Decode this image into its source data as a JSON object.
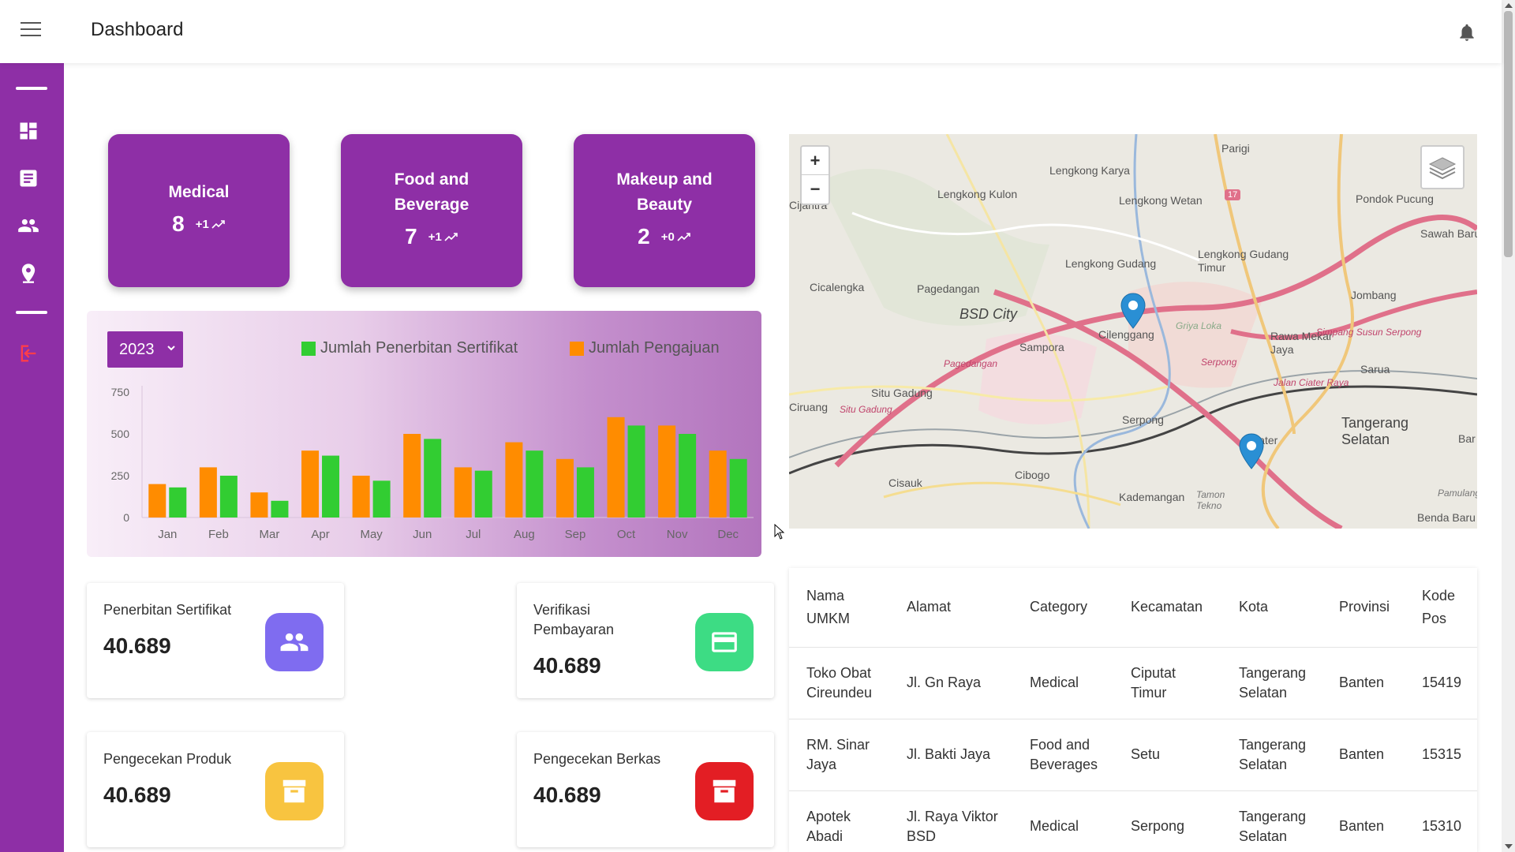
{
  "header": {
    "title": "Dashboard"
  },
  "sidebar": {
    "items": [
      {
        "icon": "dashboard-icon"
      },
      {
        "icon": "document-icon"
      },
      {
        "icon": "people-icon"
      },
      {
        "icon": "location-pin-icon"
      },
      {
        "icon": "logout-icon"
      }
    ],
    "accent": "#8e2fa6"
  },
  "categories": [
    {
      "title": "Medical",
      "count": "8",
      "delta": "+1"
    },
    {
      "title": "Food and Beverage",
      "count": "7",
      "delta": "+1"
    },
    {
      "title": "Makeup and Beauty",
      "count": "2",
      "delta": "+0"
    }
  ],
  "year_select": {
    "value": "2023"
  },
  "chart_data": {
    "type": "bar",
    "categories": [
      "Jan",
      "Feb",
      "Mar",
      "Apr",
      "May",
      "Jun",
      "Jul",
      "Aug",
      "Sep",
      "Oct",
      "Nov",
      "Dec"
    ],
    "series": [
      {
        "name": "Jumlah Pengajuan",
        "color": "#ff8c00",
        "values": [
          200,
          300,
          150,
          400,
          250,
          500,
          300,
          450,
          350,
          600,
          550,
          400
        ]
      },
      {
        "name": "Jumlah Penerbitan Sertifikat",
        "color": "#32cd32",
        "values": [
          180,
          250,
          100,
          370,
          220,
          470,
          280,
          400,
          300,
          550,
          500,
          350
        ]
      }
    ],
    "legend_order": [
      "Jumlah Penerbitan Sertifikat",
      "Jumlah Pengajuan"
    ],
    "yticks": [
      "0",
      "250",
      "500",
      "750"
    ],
    "ylim": [
      0,
      750
    ],
    "legend_position": "top-right"
  },
  "map": {
    "zoom_in": "+",
    "zoom_out": "−",
    "labels": [
      "Parigi",
      "Lengkong Karya",
      "Lengkong Kulon",
      "Lengkong Wetan",
      "Pondok Pucung",
      "Sawah Baru",
      "Lengkong Gudang",
      "Lengkong Gudang Timur",
      "Cicalengka",
      "Pagedangan",
      "BSD City",
      "Cilenggang",
      "Jombang",
      "Rawa Mekar Jaya",
      "Sampora",
      "Sarua",
      "Situ Gadung",
      "Serpong",
      "Tangerang Selatan",
      "Ciater",
      "Cibogo",
      "Cisauk",
      "Kademangan",
      "Benda Baru",
      "Cijantra",
      "Ciruang",
      "Bar"
    ],
    "road_labels": [
      "Pagedangan",
      "Situ Gadung",
      "Serpong",
      "Griya Loka",
      "Simpang Susun Serpong",
      "Jalan Ciater Raya",
      "Tamon Tekno",
      "Pamulang"
    ],
    "road_numbers": [
      "17"
    ]
  },
  "stats": [
    {
      "label": "Penerbitan Sertifikat",
      "value": "40.689",
      "icon": "people-icon",
      "color": "#7f6cf0"
    },
    {
      "label": "Verifikasi Pembayaran",
      "value": "40.689",
      "icon": "credit-card-icon",
      "color": "#3ddc84"
    },
    {
      "label": "Pengecekan Produk",
      "value": "40.689",
      "icon": "archive-box-icon",
      "color": "#f8c440"
    },
    {
      "label": "Pengecekan Berkas",
      "value": "40.689",
      "icon": "archive-box-icon",
      "color": "#e31e24"
    }
  ],
  "table": {
    "columns": [
      "Nama UMKM",
      "Alamat",
      "Category",
      "Kecamatan",
      "Kota",
      "Provinsi",
      "Kode Pos"
    ],
    "rows": [
      [
        "Toko Obat Cireundeu",
        "Jl. Gn Raya",
        "Medical",
        "Ciputat Timur",
        "Tangerang Selatan",
        "Banten",
        "15419"
      ],
      [
        "RM. Sinar Jaya",
        "Jl. Bakti Jaya",
        "Food and Beverages",
        "Setu",
        "Tangerang Selatan",
        "Banten",
        "15315"
      ],
      [
        "Apotek Abadi",
        "Jl. Raya Viktor BSD",
        "Medical",
        "Serpong",
        "Tangerang Selatan",
        "Banten",
        "15310"
      ]
    ]
  }
}
